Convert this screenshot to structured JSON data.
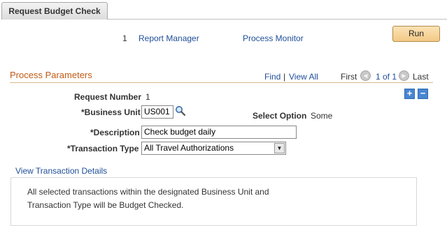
{
  "tab": {
    "label": "Request Budget Check"
  },
  "top_links": {
    "count": "1",
    "report_manager": "Report Manager",
    "process_monitor": "Process Monitor"
  },
  "run_button": "Run",
  "section": {
    "title": "Process Parameters",
    "find": "Find",
    "separator": "|",
    "view_all": "View All",
    "first": "First",
    "pager": "1 of 1",
    "last": "Last"
  },
  "form": {
    "request_number_label": "Request Number",
    "request_number_value": "1",
    "business_unit_label": "*Business Unit",
    "business_unit_value": "US001",
    "select_option_label": "Select Option",
    "select_option_value": "Some",
    "description_label": "*Description",
    "description_value": "Check budget daily",
    "transaction_type_label": "*Transaction Type",
    "transaction_type_value": "All Travel Authorizations"
  },
  "details": {
    "link": "View Transaction Details",
    "text": "All selected transactions within the designated Business Unit and Transaction Type will be Budget Checked."
  },
  "icons": {
    "lookup": "magnifier-icon",
    "prev": "left-arrow-icon",
    "next": "right-arrow-icon",
    "add": "plus-icon",
    "delete": "minus-icon",
    "dropdown": "chevron-down-icon"
  },
  "colors": {
    "link": "#1f4e98",
    "section_title": "#c05a14",
    "run_button": "#f3c985"
  }
}
